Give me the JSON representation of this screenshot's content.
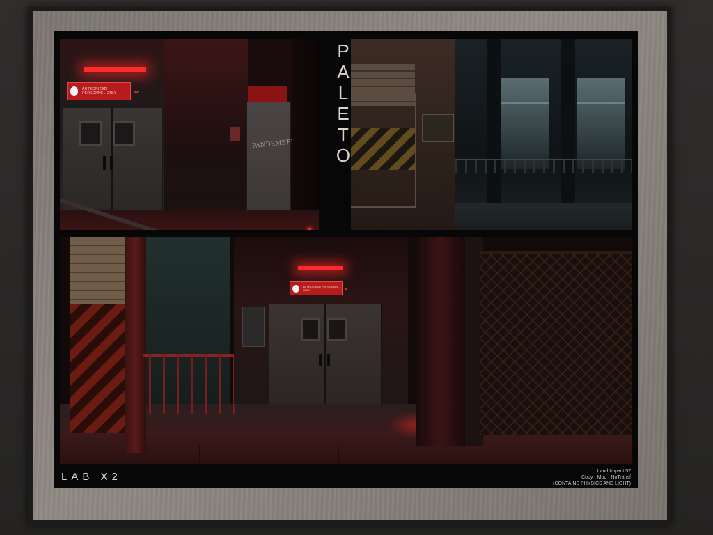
{
  "poster": {
    "title_letters": [
      "P",
      "A",
      "L",
      "E",
      "T",
      "O"
    ],
    "brand": "LAB X2",
    "info": {
      "land_impact": "Land Impact 57",
      "permissions": "Copy · Mod · NoTransf",
      "contents_note": "(CONTAINS PHYSICS AND LIGHT)"
    },
    "signs": {
      "top_left_sign": "AUTHORIZED PERSONNEL ONLY",
      "door_graffiti": "PANDEMEER"
    }
  },
  "colors": {
    "accent_red": "#ff2a2a",
    "frame_mat": "#8a847e",
    "poster_background": "#070707",
    "text": "#d8d4d0"
  },
  "icons": [
    "exclamation-icon",
    "chevron-down-icon"
  ]
}
